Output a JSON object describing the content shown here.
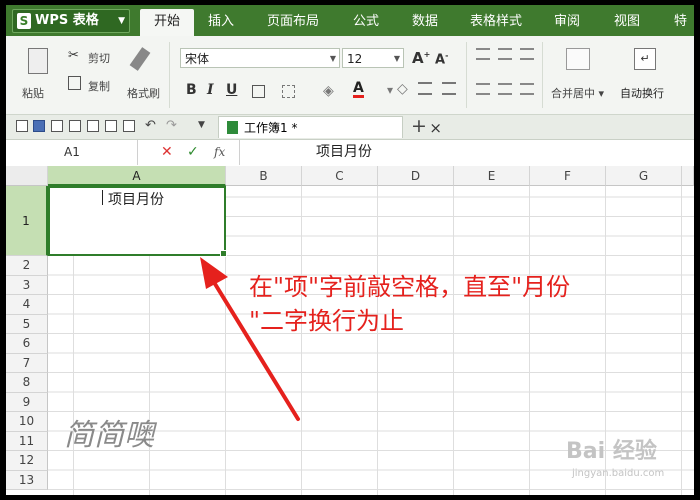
{
  "app": {
    "logo_letter": "S",
    "title": "WPS 表格"
  },
  "menu": {
    "tabs": [
      "开始",
      "插入",
      "页面布局",
      "公式",
      "数据",
      "表格样式",
      "审阅",
      "视图",
      "特"
    ]
  },
  "ribbon": {
    "paste": "粘贴",
    "cut": "剪切",
    "copy": "复制",
    "format_painter": "格式刷",
    "font_name": "宋体",
    "font_size": "12",
    "bold": "B",
    "italic": "I",
    "underline": "U",
    "merge_center": "合并居中",
    "wrap_text": "自动换行"
  },
  "quickbar": {
    "doc_name": "工作簿1 *",
    "close": "×",
    "add": "+"
  },
  "formula": {
    "cell_ref": "A1",
    "cancel": "✕",
    "confirm": "✓",
    "fx": "fx",
    "content": "项目月份"
  },
  "sheet": {
    "columns": [
      "A",
      "B",
      "C",
      "D",
      "E",
      "F",
      "G"
    ],
    "rows": [
      "1",
      "2",
      "3",
      "4",
      "5",
      "6",
      "7",
      "8",
      "9",
      "10",
      "11",
      "12",
      "13"
    ],
    "a1_value": "项目月份"
  },
  "annotation": {
    "line1": "在\"项\"字前敲空格，直至\"月份",
    "line2": "\"二字换行为止"
  },
  "watermark": {
    "text": "简简噢",
    "baidu": "Bai 经验",
    "url": "jingyan.baidu.com"
  },
  "colors": {
    "menubar": "#3f7a2e",
    "selection": "#2f7d2a",
    "annotation": "#e5211d"
  }
}
